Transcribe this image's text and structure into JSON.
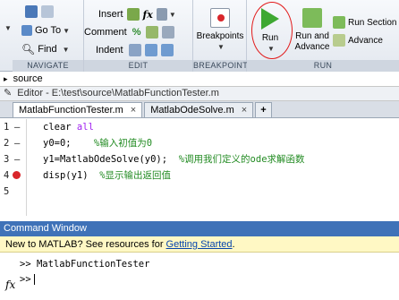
{
  "ribbon": {
    "navigate": {
      "label": "NAVIGATE",
      "goto": "Go To",
      "find": "Find"
    },
    "edit": {
      "label": "EDIT",
      "insert": "Insert",
      "comment": "Comment",
      "indent": "Indent",
      "fx": "fx"
    },
    "breakpoints": {
      "label": "BREAKPOINTS",
      "button": "Breakpoints"
    },
    "run": {
      "label": "RUN",
      "run": "Run",
      "run_advance": "Run and\nAdvance",
      "run_section": "Run Section",
      "advance": "Advance"
    }
  },
  "breadcrumb": "source",
  "editor": {
    "title": "Editor - E:\\test\\source\\MatlabFunctionTester.m",
    "tabs": [
      "MatlabFunctionTester.m",
      "MatlabOdeSolve.m"
    ],
    "plus": "+"
  },
  "code": {
    "lines": [
      {
        "num": "1",
        "kw": "clear",
        "arg": " all",
        "rest": "",
        "comment": ""
      },
      {
        "num": "2",
        "kw": "",
        "arg": "",
        "rest": "y0=0;",
        "comment": "%输入初值为0"
      },
      {
        "num": "3",
        "kw": "",
        "arg": "",
        "rest": "y1=MatlabOdeSolve(y0);",
        "comment": "%调用我们定义的ode求解函数"
      },
      {
        "num": "4",
        "kw": "",
        "arg": "",
        "rest": "disp(y1)",
        "comment": "%显示输出返回值"
      },
      {
        "num": "5",
        "kw": "",
        "arg": "",
        "rest": "",
        "comment": ""
      }
    ],
    "breakpoint_line": 4
  },
  "command_window": {
    "title": "Command Window",
    "banner_text": "New to MATLAB? See resources for ",
    "banner_link": "Getting Started",
    "banner_end": ".",
    "history_prompt": ">>",
    "history_cmd": "MatlabFunctionTester",
    "fx": "fx",
    "prompt": ">>"
  },
  "colors": {
    "accent_title": "#3f72b8",
    "run_circle": "#e21b1b",
    "breakpoint": "#d9262b",
    "comment": "#228b22",
    "keyword": "#a020f0"
  }
}
